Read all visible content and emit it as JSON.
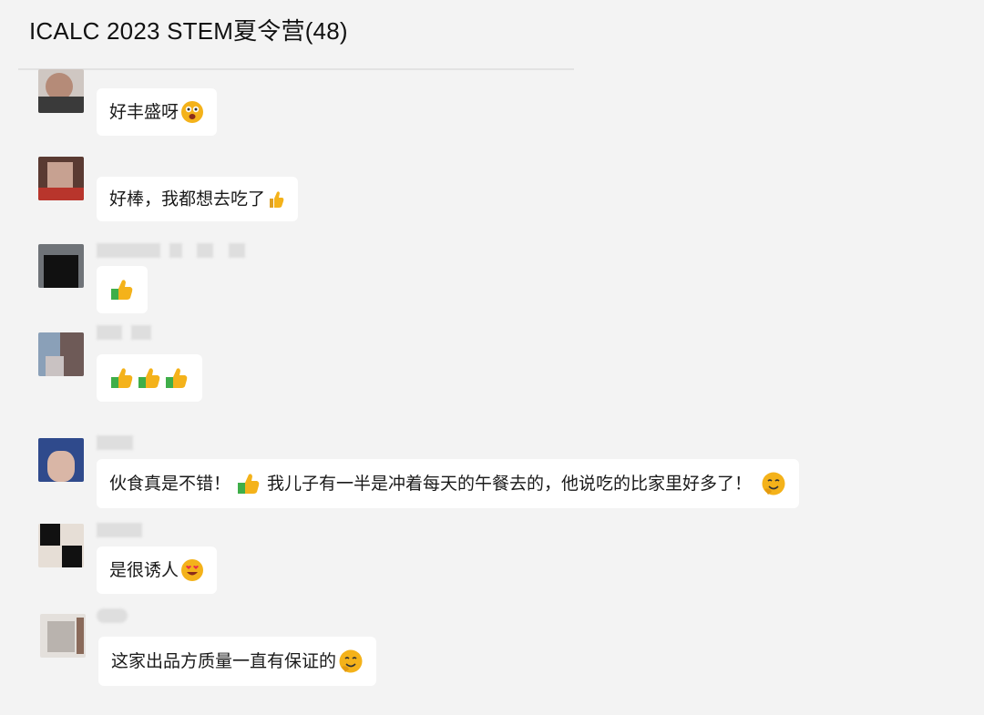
{
  "header": {
    "title": "ICALC 2023 STEM夏令营(48)"
  },
  "messages": [
    {
      "text": "好丰盛呀",
      "emoji": [
        "face-icon"
      ]
    },
    {
      "text": "好棒，我都想去吃了",
      "emoji": [
        "thumbs-up-icon"
      ]
    },
    {
      "text": "",
      "emoji": [
        "thumbs-up-icon"
      ]
    },
    {
      "text": "",
      "emoji": [
        "thumbs-up-icon",
        "thumbs-up-icon",
        "thumbs-up-icon"
      ]
    },
    {
      "text": "伙食真是不错！",
      "emoji": [
        "thumbs-up-icon"
      ],
      "text2": "我儿子有一半是冲着每天的午餐去的，他说吃的比家里好多了！",
      "emoji2": [
        "grin-face-icon"
      ]
    },
    {
      "text": "是很诱人",
      "emoji": [
        "heart-eyes-icon"
      ]
    },
    {
      "text": "这家出品方质量一直有保证的",
      "emoji": [
        "grin-face-icon"
      ]
    }
  ],
  "colors": {
    "background": "#f3f3f3",
    "bubble": "#ffffff",
    "emoji_yellow": "#f4b21a",
    "emoji_green": "#3fae49"
  }
}
